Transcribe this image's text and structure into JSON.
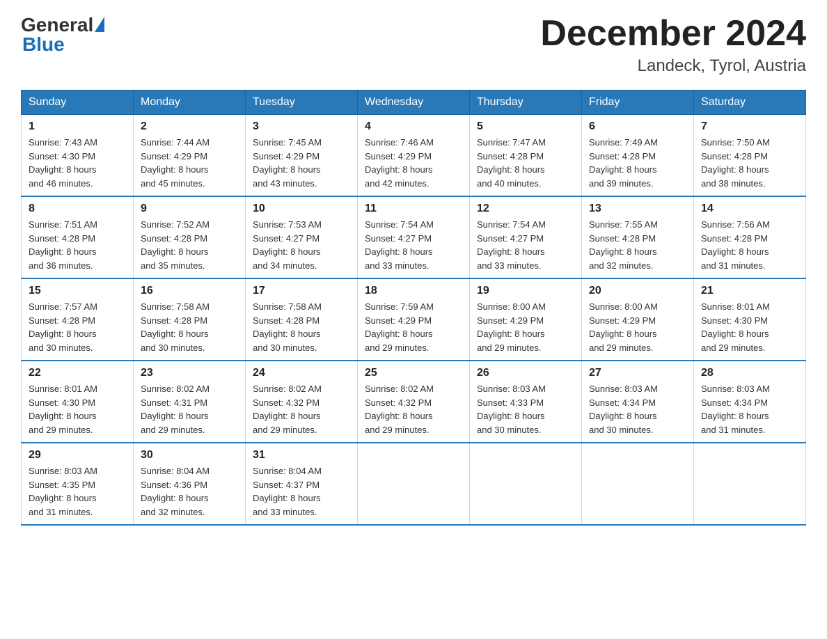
{
  "header": {
    "logo_general": "General",
    "logo_blue": "Blue",
    "month_title": "December 2024",
    "location": "Landeck, Tyrol, Austria"
  },
  "weekdays": [
    "Sunday",
    "Monday",
    "Tuesday",
    "Wednesday",
    "Thursday",
    "Friday",
    "Saturday"
  ],
  "weeks": [
    [
      {
        "day": "1",
        "sunrise": "7:43 AM",
        "sunset": "4:30 PM",
        "daylight": "8 hours and 46 minutes."
      },
      {
        "day": "2",
        "sunrise": "7:44 AM",
        "sunset": "4:29 PM",
        "daylight": "8 hours and 45 minutes."
      },
      {
        "day": "3",
        "sunrise": "7:45 AM",
        "sunset": "4:29 PM",
        "daylight": "8 hours and 43 minutes."
      },
      {
        "day": "4",
        "sunrise": "7:46 AM",
        "sunset": "4:29 PM",
        "daylight": "8 hours and 42 minutes."
      },
      {
        "day": "5",
        "sunrise": "7:47 AM",
        "sunset": "4:28 PM",
        "daylight": "8 hours and 40 minutes."
      },
      {
        "day": "6",
        "sunrise": "7:49 AM",
        "sunset": "4:28 PM",
        "daylight": "8 hours and 39 minutes."
      },
      {
        "day": "7",
        "sunrise": "7:50 AM",
        "sunset": "4:28 PM",
        "daylight": "8 hours and 38 minutes."
      }
    ],
    [
      {
        "day": "8",
        "sunrise": "7:51 AM",
        "sunset": "4:28 PM",
        "daylight": "8 hours and 36 minutes."
      },
      {
        "day": "9",
        "sunrise": "7:52 AM",
        "sunset": "4:28 PM",
        "daylight": "8 hours and 35 minutes."
      },
      {
        "day": "10",
        "sunrise": "7:53 AM",
        "sunset": "4:27 PM",
        "daylight": "8 hours and 34 minutes."
      },
      {
        "day": "11",
        "sunrise": "7:54 AM",
        "sunset": "4:27 PM",
        "daylight": "8 hours and 33 minutes."
      },
      {
        "day": "12",
        "sunrise": "7:54 AM",
        "sunset": "4:27 PM",
        "daylight": "8 hours and 33 minutes."
      },
      {
        "day": "13",
        "sunrise": "7:55 AM",
        "sunset": "4:28 PM",
        "daylight": "8 hours and 32 minutes."
      },
      {
        "day": "14",
        "sunrise": "7:56 AM",
        "sunset": "4:28 PM",
        "daylight": "8 hours and 31 minutes."
      }
    ],
    [
      {
        "day": "15",
        "sunrise": "7:57 AM",
        "sunset": "4:28 PM",
        "daylight": "8 hours and 30 minutes."
      },
      {
        "day": "16",
        "sunrise": "7:58 AM",
        "sunset": "4:28 PM",
        "daylight": "8 hours and 30 minutes."
      },
      {
        "day": "17",
        "sunrise": "7:58 AM",
        "sunset": "4:28 PM",
        "daylight": "8 hours and 30 minutes."
      },
      {
        "day": "18",
        "sunrise": "7:59 AM",
        "sunset": "4:29 PM",
        "daylight": "8 hours and 29 minutes."
      },
      {
        "day": "19",
        "sunrise": "8:00 AM",
        "sunset": "4:29 PM",
        "daylight": "8 hours and 29 minutes."
      },
      {
        "day": "20",
        "sunrise": "8:00 AM",
        "sunset": "4:29 PM",
        "daylight": "8 hours and 29 minutes."
      },
      {
        "day": "21",
        "sunrise": "8:01 AM",
        "sunset": "4:30 PM",
        "daylight": "8 hours and 29 minutes."
      }
    ],
    [
      {
        "day": "22",
        "sunrise": "8:01 AM",
        "sunset": "4:30 PM",
        "daylight": "8 hours and 29 minutes."
      },
      {
        "day": "23",
        "sunrise": "8:02 AM",
        "sunset": "4:31 PM",
        "daylight": "8 hours and 29 minutes."
      },
      {
        "day": "24",
        "sunrise": "8:02 AM",
        "sunset": "4:32 PM",
        "daylight": "8 hours and 29 minutes."
      },
      {
        "day": "25",
        "sunrise": "8:02 AM",
        "sunset": "4:32 PM",
        "daylight": "8 hours and 29 minutes."
      },
      {
        "day": "26",
        "sunrise": "8:03 AM",
        "sunset": "4:33 PM",
        "daylight": "8 hours and 30 minutes."
      },
      {
        "day": "27",
        "sunrise": "8:03 AM",
        "sunset": "4:34 PM",
        "daylight": "8 hours and 30 minutes."
      },
      {
        "day": "28",
        "sunrise": "8:03 AM",
        "sunset": "4:34 PM",
        "daylight": "8 hours and 31 minutes."
      }
    ],
    [
      {
        "day": "29",
        "sunrise": "8:03 AM",
        "sunset": "4:35 PM",
        "daylight": "8 hours and 31 minutes."
      },
      {
        "day": "30",
        "sunrise": "8:04 AM",
        "sunset": "4:36 PM",
        "daylight": "8 hours and 32 minutes."
      },
      {
        "day": "31",
        "sunrise": "8:04 AM",
        "sunset": "4:37 PM",
        "daylight": "8 hours and 33 minutes."
      },
      null,
      null,
      null,
      null
    ]
  ],
  "labels": {
    "sunrise": "Sunrise:",
    "sunset": "Sunset:",
    "daylight": "Daylight:"
  }
}
